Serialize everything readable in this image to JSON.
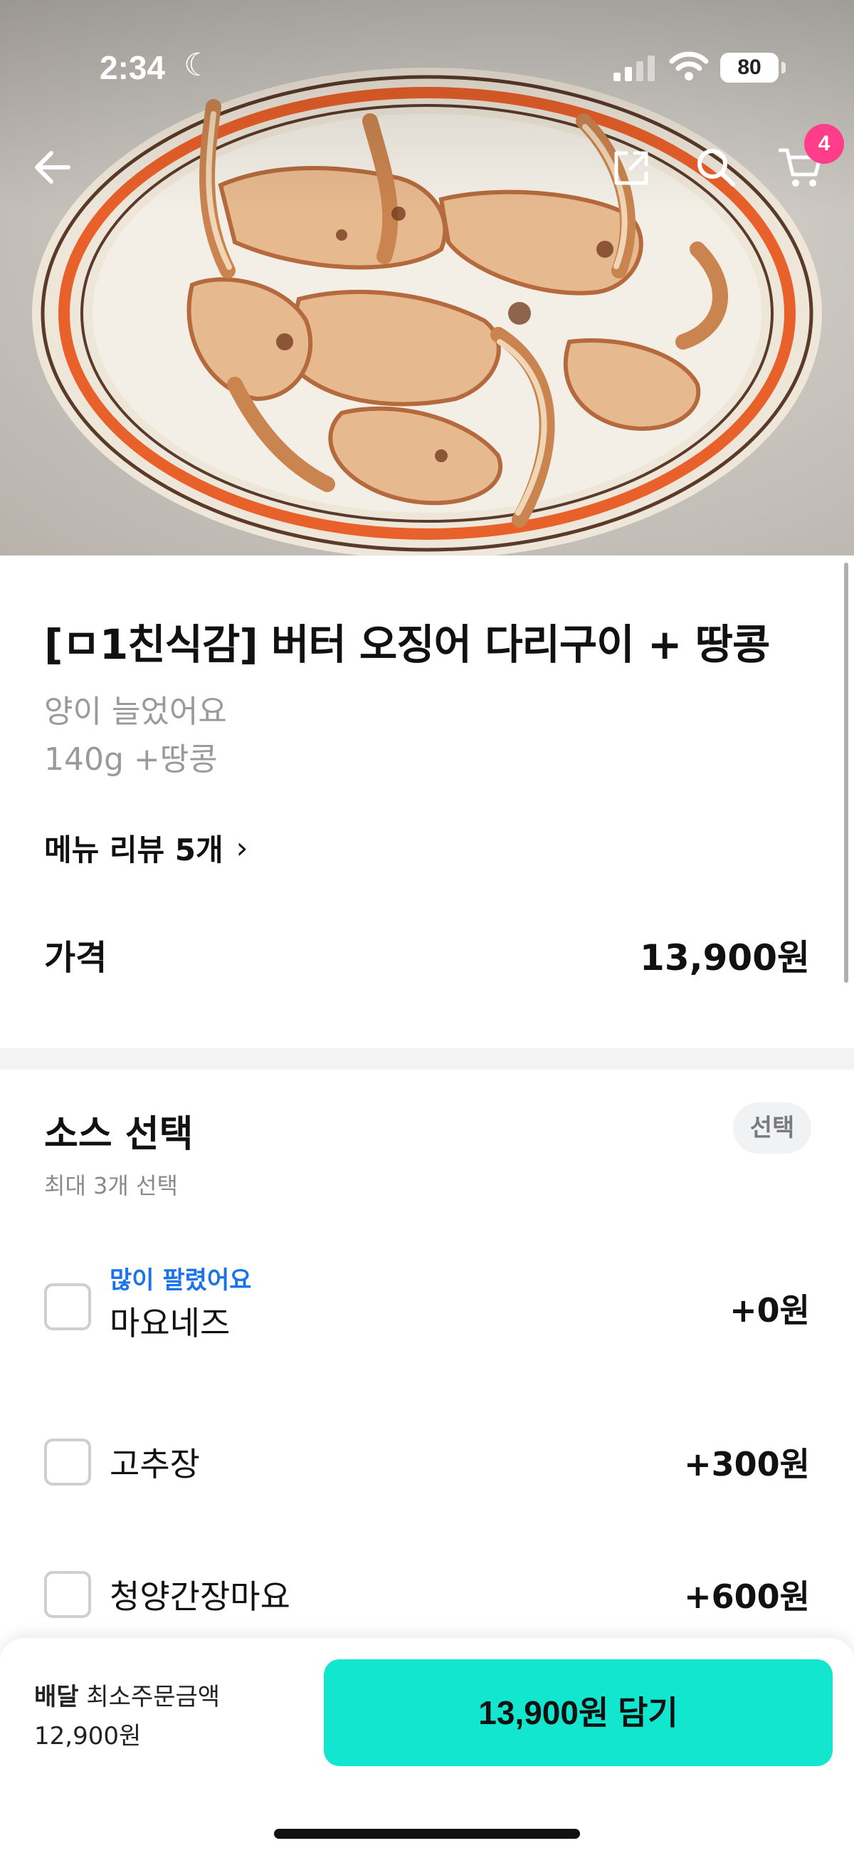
{
  "status_bar": {
    "time": "2:34",
    "battery": "80"
  },
  "nav": {
    "cart_count": "4"
  },
  "product": {
    "title": "[ㅁ1친식감] 버터 오징어 다리구이 + 땅콩",
    "description_lines": [
      "양이 늘었어요",
      "140g +땅콩"
    ],
    "review_link": "메뉴 리뷰 5개",
    "price_label": "가격",
    "price_value": "13,900원"
  },
  "options": {
    "title": "소스 선택",
    "subtitle": "최대 3개 선택",
    "badge": "선택",
    "items": [
      {
        "tag": "많이 팔렸어요",
        "label": "마요네즈",
        "price": "+0원",
        "checked": false
      },
      {
        "tag": "",
        "label": "고추장",
        "price": "+300원",
        "checked": false
      },
      {
        "tag": "",
        "label": "청양간장마요",
        "price": "+600원",
        "checked": false
      }
    ]
  },
  "bottom_bar": {
    "delivery_label": "배달",
    "min_order_label": "최소주문금액",
    "min_order_value": "12,900원",
    "add_button": "13,900원 담기"
  },
  "colors": {
    "accent": "#13e6cf",
    "badge": "#ff3d8b",
    "tag_blue": "#1a73e8"
  }
}
